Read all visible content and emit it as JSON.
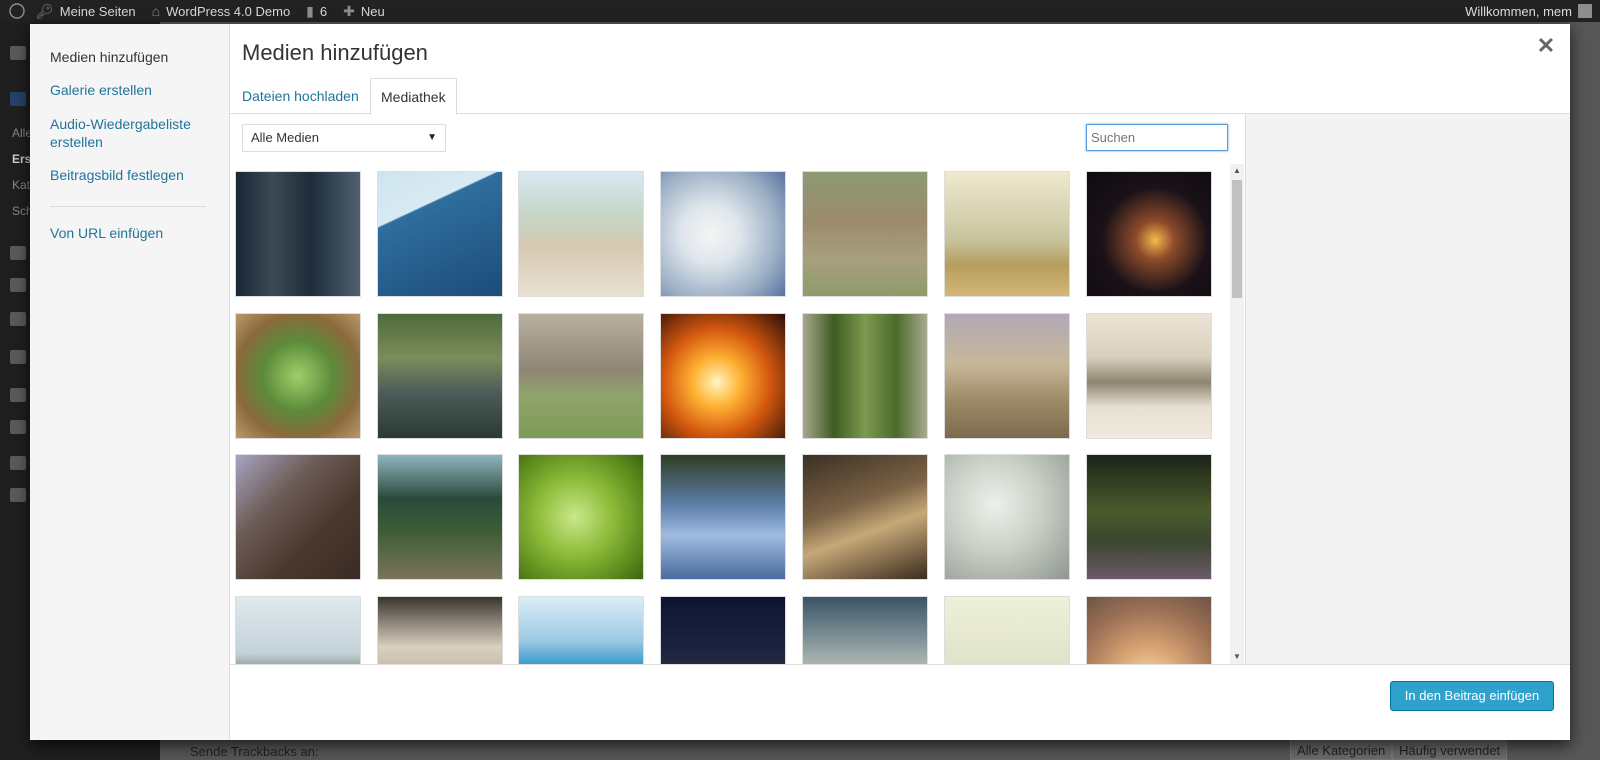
{
  "admin_bar": {
    "items": [
      "Meine Seiten",
      "WordPress 4.0 Demo",
      "6",
      "Neu"
    ],
    "right": "Willkommen, mem"
  },
  "admin_menu": {
    "fragments": [
      "Alle",
      "Ers",
      "Kat",
      "Sch"
    ]
  },
  "background": {
    "bottom_text": "Sende Trackbacks an:",
    "tabs": [
      "Alle Kategorien",
      "Häufig verwendet"
    ]
  },
  "modal": {
    "title": "Medien hinzufügen",
    "close_icon": "close-icon",
    "menu": [
      "Medien hinzufügen",
      "Galerie erstellen",
      "Audio-Wiedergabeliste erstellen",
      "Beitragsbild festlegen",
      "Von URL einfügen"
    ],
    "tabs": [
      "Dateien hochladen",
      "Mediathek"
    ],
    "active_tab": "Mediathek",
    "filter": {
      "selected": "Alle Medien"
    },
    "search": {
      "placeholder": "Suchen"
    },
    "insert_button": "In den Beitrag einfügen"
  },
  "colors": {
    "link": "#21759b",
    "primary_button": "#2ea2cc"
  },
  "thumbnails": [
    {
      "name": "pine-forest-thumbnail",
      "bg": "linear-gradient(90deg,#1a2735 0%,#3c4a56 30%,#1e2c3a 60%,#516170 100%)"
    },
    {
      "name": "ocean-horizon-thumbnail",
      "bg": "linear-gradient(155deg,#cfe4ef 0%,#d8ebf5 30%,#2f6e9e 31%,#1c4c7a 100%)"
    },
    {
      "name": "horse-field-thumbnail",
      "bg": "linear-gradient(180deg,#d9e8f2 0%,#c6d6c6 35%,#d5c9b2 60%,#e8e0d0 100%)"
    },
    {
      "name": "white-blossom-thumbnail",
      "bg": "radial-gradient(circle at 40% 50%,#f4f4f4 0%,#dfe6ec 30%,#9aaec4 70%,#5873a0 100%)"
    },
    {
      "name": "cows-grass-thumbnail",
      "bg": "linear-gradient(180deg,#8b9a73 0%,#9c8b6e 40%,#a89f7f 70%,#8e9c6a 100%)"
    },
    {
      "name": "wind-turbine-thumbnail",
      "bg": "linear-gradient(180deg,#efe9cf 0%,#c8c39d 55%,#b59e5e 75%,#d4b679 100%)"
    },
    {
      "name": "fire-embers-thumbnail",
      "bg": "radial-gradient(circle at 55% 55%,#f5b94d 0%,#8d4b2b 20%,#1a1218 55%,#0e0a10 100%)"
    },
    {
      "name": "green-apples-thumbnail",
      "bg": "radial-gradient(circle at 50% 50%,#9fcf6a 0%,#5c8b3a 40%,#8a6a3c 70%,#b89a6a 100%)"
    },
    {
      "name": "waterfall-rocks-thumbnail",
      "bg": "linear-gradient(180deg,#4e6a38 0%,#7a8d5b 35%,#4b5a58 65%,#2b3a30 100%)"
    },
    {
      "name": "orchard-trees-thumbnail",
      "bg": "linear-gradient(180deg,#b9b0a0 0%,#8e8575 45%,#8fa36a 65%,#7f9b58 100%)"
    },
    {
      "name": "fireplace-flame-thumbnail",
      "bg": "radial-gradient(circle at 45% 55%,#fff6c2 0%,#ffb233 25%,#d4580f 55%,#2a0f06 100%)"
    },
    {
      "name": "grass-blades-thumbnail",
      "bg": "linear-gradient(90deg,#a6a88e 0%,#3e5b22 25%,#7e9950 50%,#4b6a2b 75%,#a7aa8f 100%)"
    },
    {
      "name": "wheat-field-thumbnail",
      "bg": "linear-gradient(180deg,#b1a8b5 0%,#c7b79a 40%,#9e8a65 70%,#7a6b4f 100%)"
    },
    {
      "name": "lake-village-thumbnail",
      "bg": "linear-gradient(180deg,#ece4d6 0%,#d8cfbd 35%,#8d8470 55%,#e7e0d2 75%,#efe9de 100%)"
    },
    {
      "name": "horse-portrait-thumbnail",
      "bg": "linear-gradient(135deg,#a8a3c2 0%,#6b5a55 35%,#4a382e 65%,#3a2b24 100%)"
    },
    {
      "name": "cornfield-thumbnail",
      "bg": "linear-gradient(180deg,#8fb5c2 0%,#2c4a3a 35%,#3b5c36 60%,#7a735b 100%)"
    },
    {
      "name": "green-bokeh-thumbnail",
      "bg": "radial-gradient(circle at 45% 50%,#c9e88a 0%,#8fbd3b 40%,#5e8c1d 75%,#3b6410 100%)"
    },
    {
      "name": "sky-reflection-thumbnail",
      "bg": "linear-gradient(180deg,#2f3d24 0%,#5c7ea8 40%,#9fbbe0 65%,#4a6b9c 100%)"
    },
    {
      "name": "knife-forest-thumbnail",
      "bg": "linear-gradient(160deg,#3b3024 0%,#7a6245 40%,#c7a878 60%,#3a2c1e 100%)"
    },
    {
      "name": "raindrops-glass-thumbnail",
      "bg": "radial-gradient(circle at 40% 40%,#eef0ea 0%,#c9cfc6 45%,#8e978f 100%)"
    },
    {
      "name": "old-tree-thumbnail",
      "bg": "linear-gradient(180deg,#1c2418 0%,#4b5a2c 45%,#3b4630 70%,#6b5a6a 100%)"
    },
    {
      "name": "hillside-town-thumbnail",
      "bg": "linear-gradient(180deg,#dfe9ee 0%,#c4d2d8 45%,#5f6b5b 70%,#7b7f6a 100%)"
    },
    {
      "name": "white-cows-thumbnail",
      "bg": "linear-gradient(180deg,#3a352d 0%,#d8d0c0 40%,#b9ae9a 70%,#5a5040 100%)"
    },
    {
      "name": "blue-sea-coast-thumbnail",
      "bg": "linear-gradient(180deg,#dbeef6 0%,#9cc9e3 35%,#1e8cc8 60%,#35b0de 100%)"
    },
    {
      "name": "night-cabin-thumbnail",
      "bg": "linear-gradient(180deg,#0e1430 0%,#1c2444 45%,#3a3230 75%,#2a2018 100%)"
    },
    {
      "name": "cloudy-sky-thumbnail",
      "bg": "linear-gradient(180deg,#3a5466 0%,#98a7a8 45%,#c9cbbc 70%,#7c8b90 100%)"
    },
    {
      "name": "beach-huts-thumbnail",
      "bg": "linear-gradient(180deg,#eef1d8 0%,#dfe2c8 55%,#c43a5c 75%,#8a7a68 100%)"
    },
    {
      "name": "sunset-tree-thumbnail",
      "bg": "radial-gradient(circle at 50% 70%,#f6e0b6 0%,#d8a272 35%,#9b7055 70%,#6e5444 100%)"
    }
  ]
}
